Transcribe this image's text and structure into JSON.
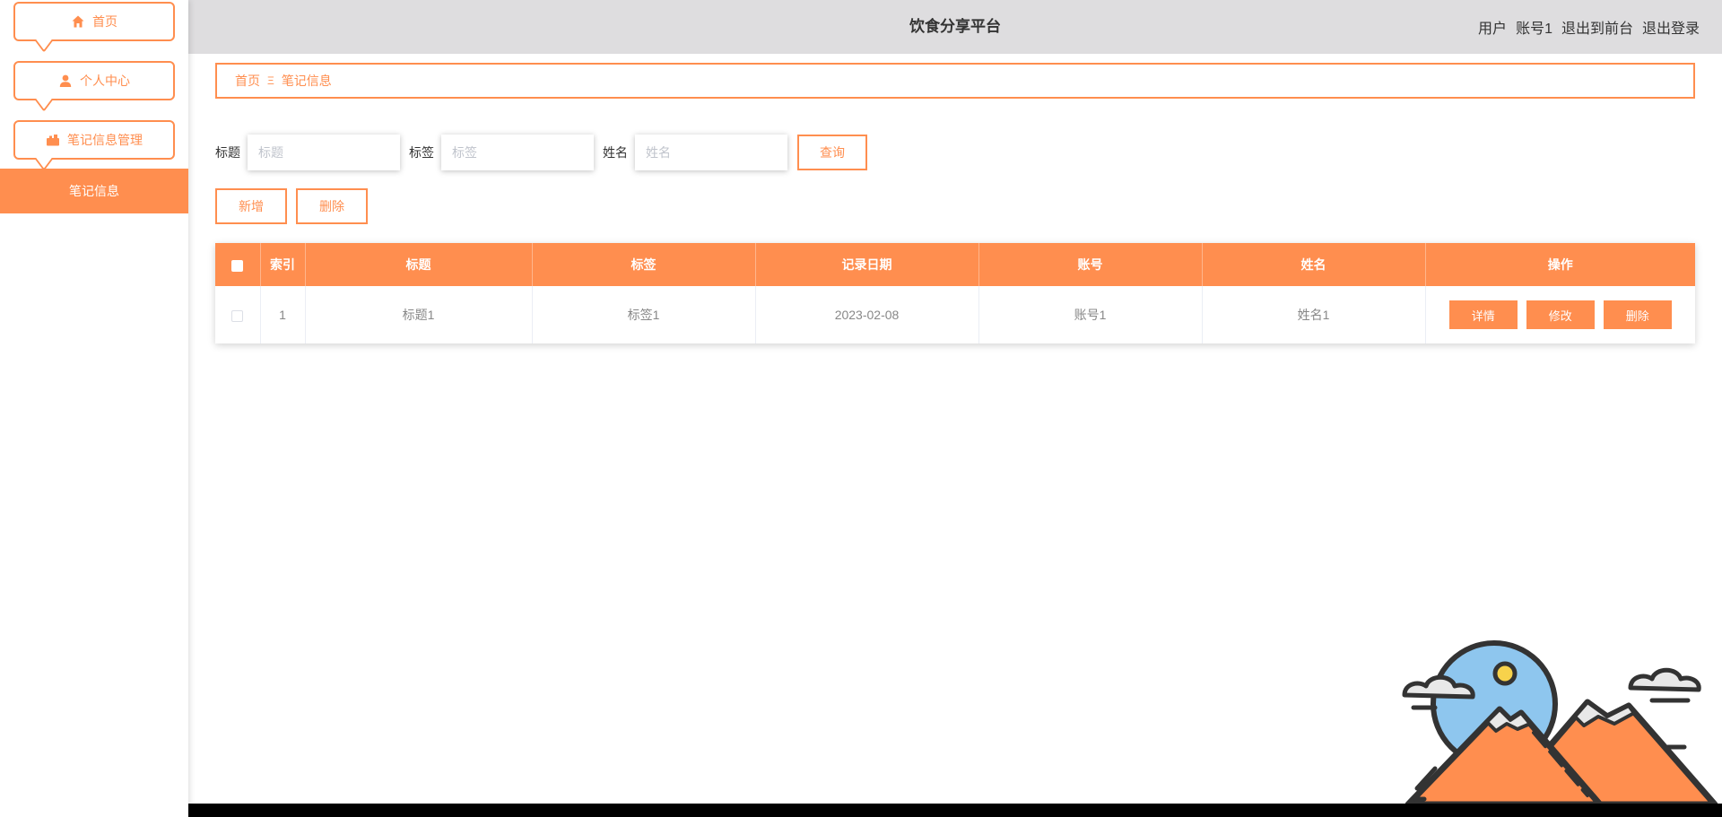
{
  "app": {
    "title": "饮食分享平台"
  },
  "header": {
    "user_role": "用户",
    "user_name": "账号1",
    "exit_front": "退出到前台",
    "logout": "退出登录"
  },
  "sidebar": {
    "items": [
      {
        "label": "首页",
        "icon": "home-icon"
      },
      {
        "label": "个人中心",
        "icon": "user-icon"
      },
      {
        "label": "笔记信息管理",
        "icon": "folder-icon"
      }
    ],
    "submenu": [
      {
        "label": "笔记信息"
      }
    ]
  },
  "breadcrumb": {
    "home": "首页",
    "separator": "Ξ",
    "current": "笔记信息"
  },
  "search": {
    "fields": [
      {
        "label": "标题",
        "placeholder": "标题"
      },
      {
        "label": "标签",
        "placeholder": "标签"
      },
      {
        "label": "姓名",
        "placeholder": "姓名"
      }
    ],
    "query_label": "查询"
  },
  "actions": {
    "add_label": "新增",
    "delete_label": "删除"
  },
  "table": {
    "columns": [
      "索引",
      "标题",
      "标签",
      "记录日期",
      "账号",
      "姓名",
      "操作"
    ],
    "rows": [
      {
        "index": "1",
        "title": "标题1",
        "tag": "标签1",
        "date": "2023-02-08",
        "account": "账号1",
        "name": "姓名1"
      }
    ],
    "row_actions": {
      "detail": "详情",
      "edit": "修改",
      "delete": "删除"
    }
  },
  "colors": {
    "accent": "#FF8E4F",
    "header_bg": "#DEDDDF",
    "sky": "#8EC6EE",
    "outline": "#333333"
  }
}
